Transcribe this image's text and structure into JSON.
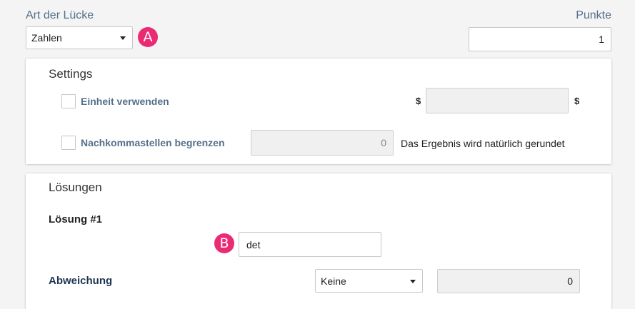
{
  "header": {
    "gap_type_label": "Art der Lücke",
    "points_label": "Punkte",
    "gap_type_value": "Zahlen",
    "points_value": "1"
  },
  "markers": {
    "a": "A",
    "b": "B"
  },
  "settings": {
    "title": "Settings",
    "unit_label": "Einheit verwenden",
    "unit_prefix": "$",
    "unit_suffix": "$",
    "decimals_label": "Nachkommastellen begrenzen",
    "decimals_value": "0",
    "decimals_hint": "Das Ergebnis wird natürlich gerundet"
  },
  "solutions": {
    "title": "Lösungen",
    "solution_label": "Lösung #1",
    "solution_value": "det",
    "deviation_label": "Abweichung",
    "deviation_select": "Keine",
    "deviation_value": "0"
  },
  "colors": {
    "badge": "#ec2a74",
    "label_blue": "#55708a",
    "dark_navy": "#1e3550"
  }
}
